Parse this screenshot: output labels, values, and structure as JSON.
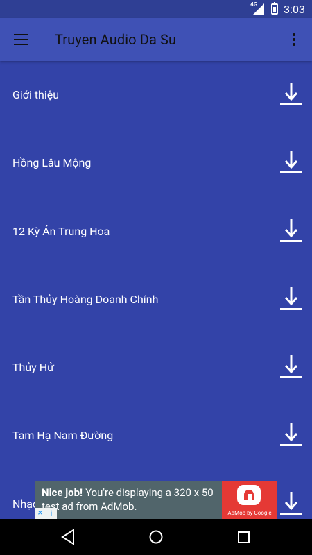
{
  "status_bar": {
    "network": "4G",
    "time": "3:03"
  },
  "app_bar": {
    "title": "Truyen Audio Da Su"
  },
  "list": {
    "items": [
      {
        "label": "Giới thiệu"
      },
      {
        "label": "Hồng Lâu Mộng"
      },
      {
        "label": "12 Kỳ Án Trung Hoa"
      },
      {
        "label": "Tần Thủy Hoàng Doanh Chính"
      },
      {
        "label": "Thủy Hử"
      },
      {
        "label": "Tam Hạ Nam Đường"
      },
      {
        "label": "Nhạc"
      }
    ]
  },
  "ad": {
    "headline": "Nice job!",
    "body": "You're displaying a 320 x 50 test ad from AdMob.",
    "brand": "AdMob by Google",
    "close_icon": "×",
    "info_icon": "i"
  },
  "nav": {
    "back": "back-icon",
    "home": "home-icon",
    "recents": "recents-icon"
  }
}
